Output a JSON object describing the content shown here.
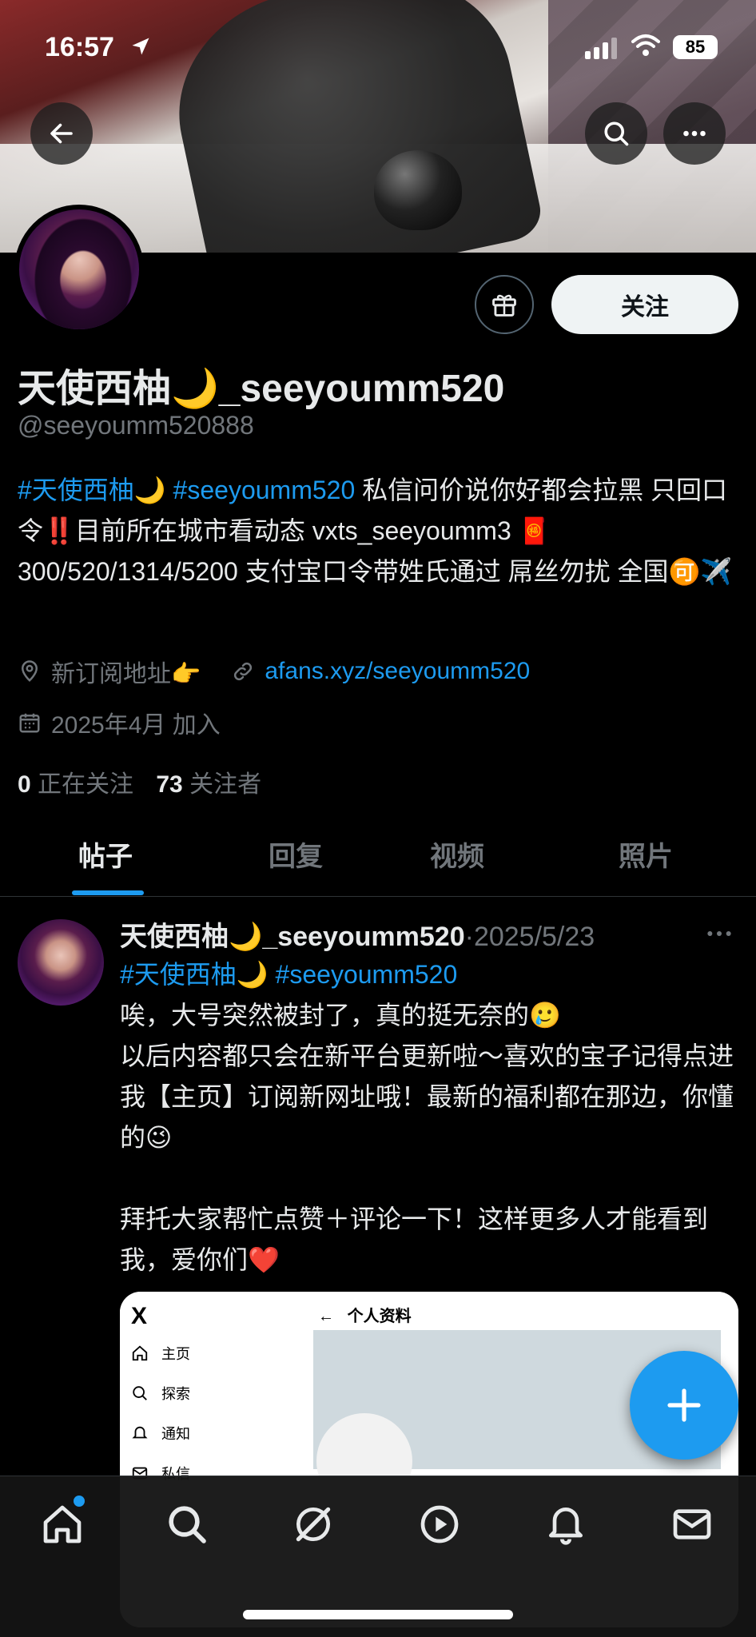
{
  "status_bar": {
    "time": "16:57",
    "battery": "85"
  },
  "profile": {
    "follow_label": "关注",
    "display_name": "天使西柚🌙_seeyoumm520",
    "handle": "@seeyoumm520888",
    "bio": {
      "tag1": "#天使西柚🌙",
      "tag2": "#seeyoumm520",
      "text_a": " 私信问价说你好都会拉黑 只回口令",
      "exclaim": "‼️",
      "text_b": "目前所在城市看动态 vxts_seeyoumm3 🧧300/520/1314/5200 支付宝口令带姓氏通过 屌丝勿扰 全国🉑✈️"
    },
    "location": "新订阅地址👉",
    "website": "afans.xyz/seeyoumm520",
    "joined": "2025年4月 加入",
    "following_count": "0",
    "following_label": "正在关注",
    "followers_count": "73",
    "followers_label": "关注者"
  },
  "tabs": [
    {
      "label": "帖子"
    },
    {
      "label": "回复"
    },
    {
      "label": "视频"
    },
    {
      "label": "照片"
    }
  ],
  "post": {
    "name": "天使西柚🌙_seeyoumm520",
    "dot": "·",
    "date": "2025/5/23",
    "tag1": "#天使西柚🌙",
    "tag2": "#seeyoumm520",
    "line1": "唉，大号突然被封了，真的挺无奈的🥲",
    "line2": "以后内容都只会在新平台更新啦～喜欢的宝子记得点进我【主页】订阅新网址哦！最新的福利都在那边，你懂的😉",
    "line3": "拜托大家帮忙点赞＋评论一下！这样更多人才能看到我，爱你们❤️",
    "media": {
      "logo": "X",
      "nav": [
        "主页",
        "探索",
        "通知",
        "私信"
      ],
      "topbar_title": "个人资料"
    }
  },
  "colors": {
    "accent": "#1d9bf0",
    "secondary_text": "#71767b",
    "background": "#000000"
  }
}
